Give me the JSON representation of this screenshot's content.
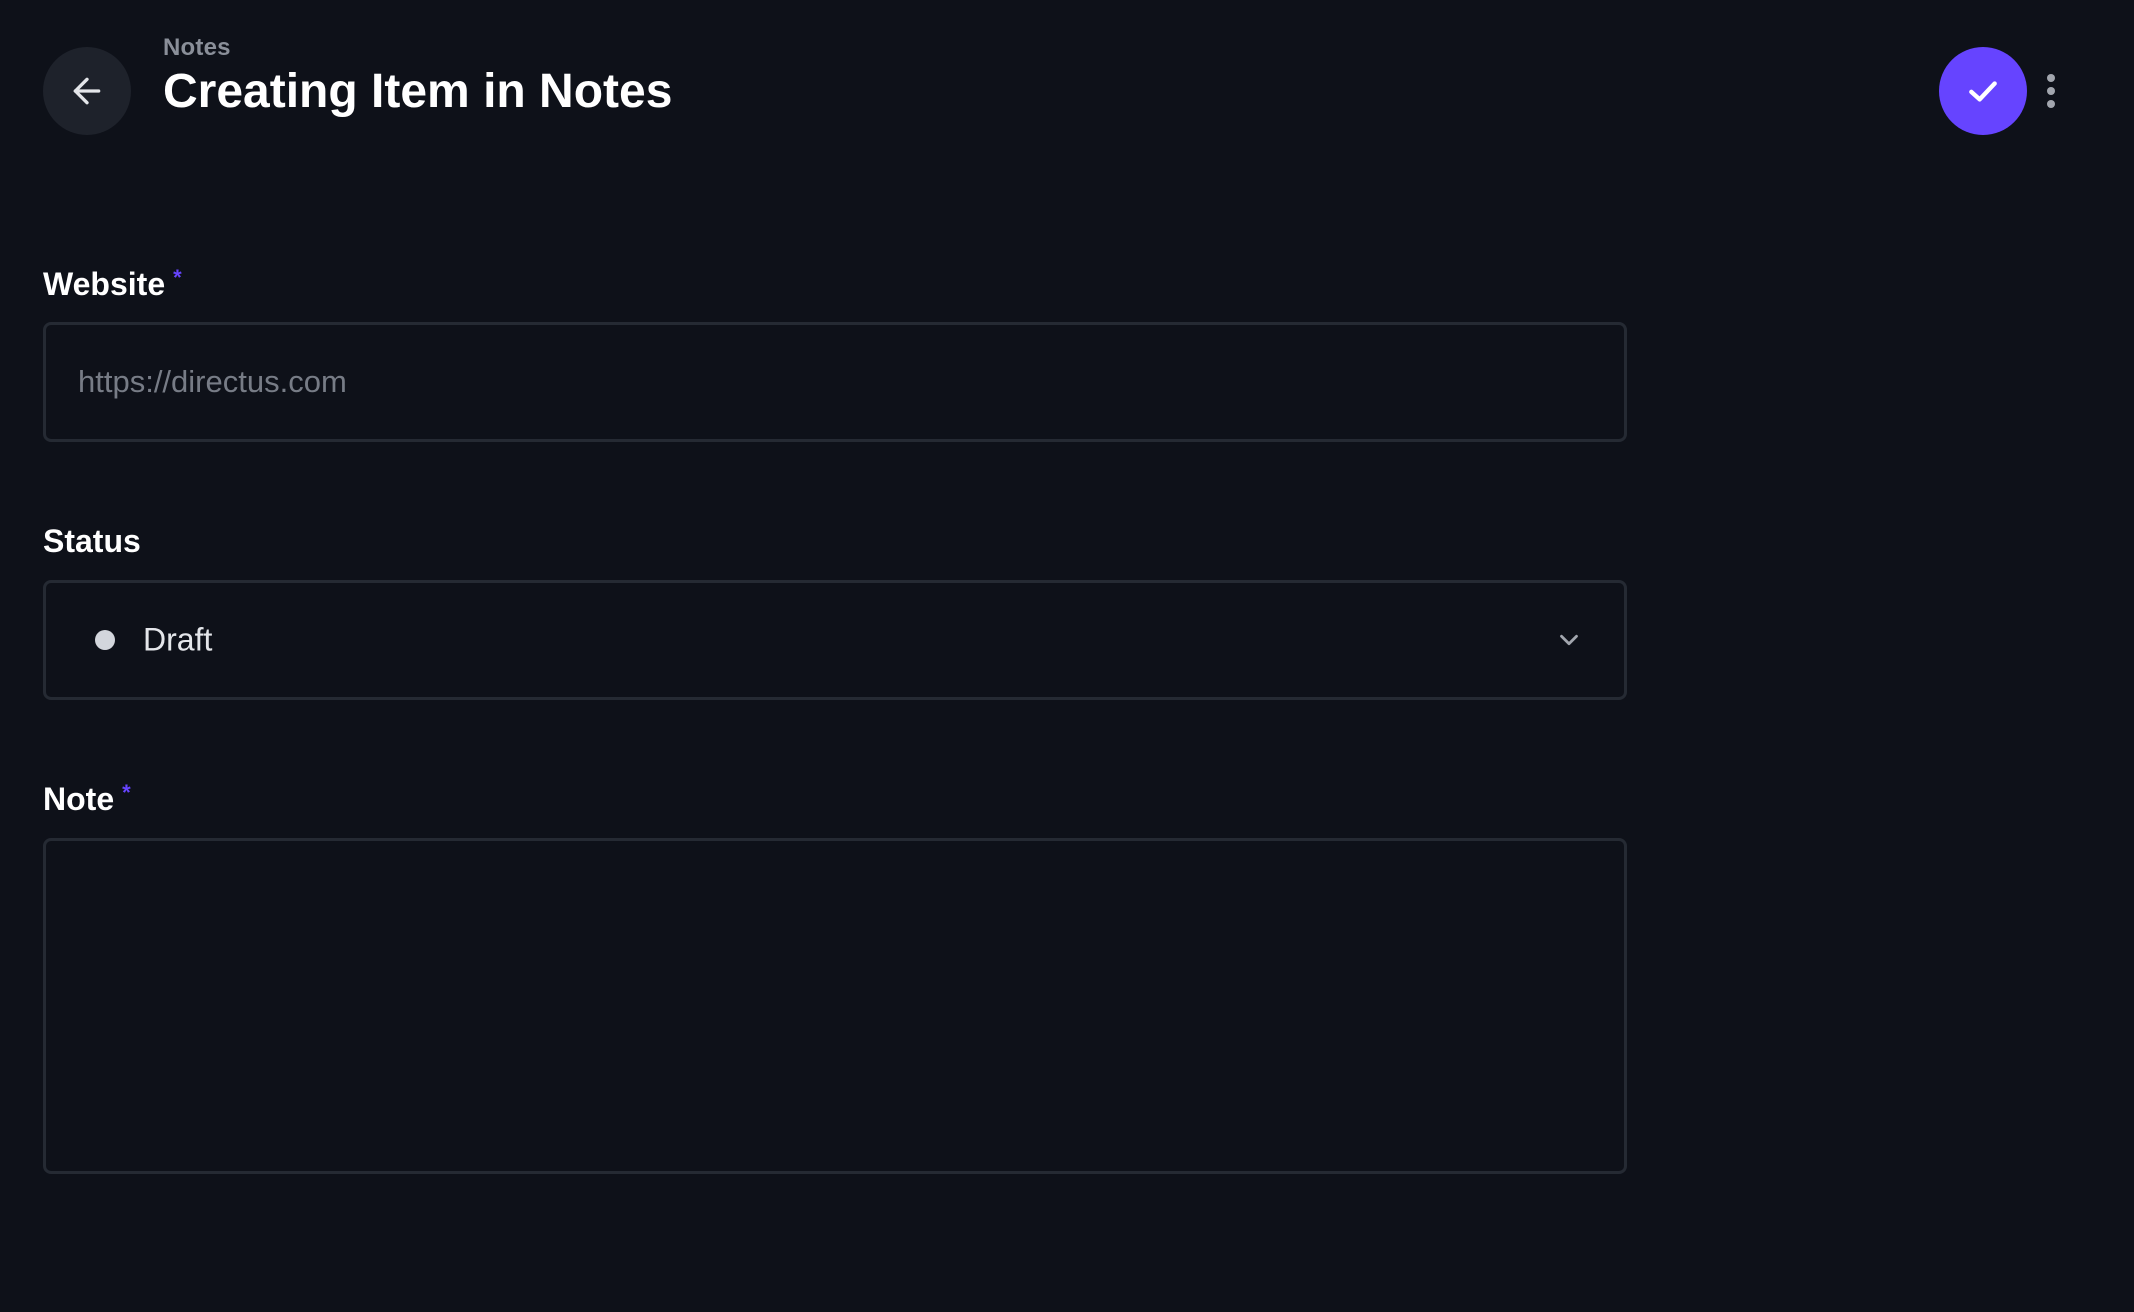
{
  "header": {
    "breadcrumb": "Notes",
    "title": "Creating Item in Notes",
    "back_icon": "arrow-left-icon",
    "save_icon": "check-icon",
    "more_icon": "more-vertical-icon"
  },
  "form": {
    "website": {
      "label": "Website",
      "required_mark": "*",
      "value": "",
      "placeholder": "https://directus.com"
    },
    "status": {
      "label": "Status",
      "selected": "Draft",
      "dot_color": "#d3d6dc",
      "chevron_icon": "chevron-down-icon"
    },
    "note": {
      "label": "Note",
      "required_mark": "*",
      "value": ""
    }
  },
  "colors": {
    "background": "#0e1119",
    "accent": "#6644ff",
    "border": "#252a33",
    "muted_text": "#8a8f99"
  }
}
